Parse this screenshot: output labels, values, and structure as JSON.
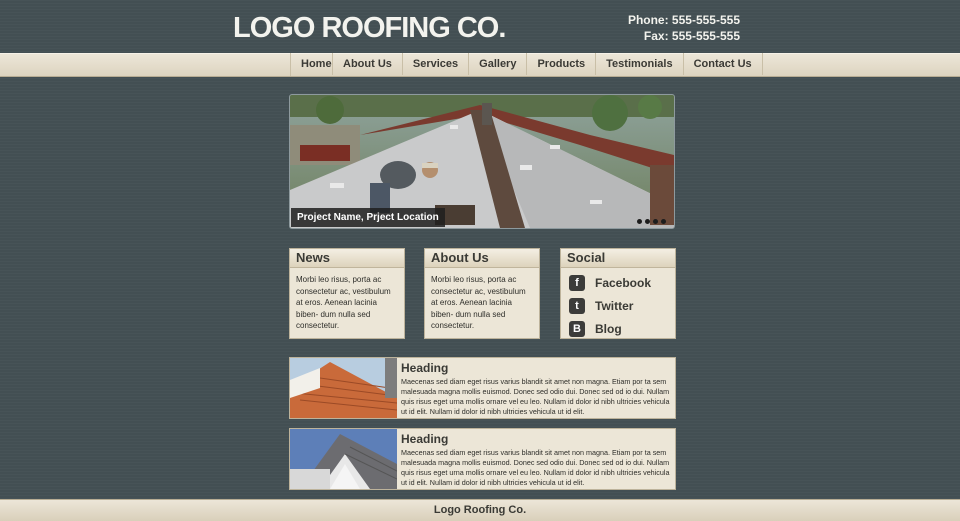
{
  "header": {
    "logo": "LOGO ROOFING CO.",
    "phone": "Phone: 555-555-555",
    "fax": "Fax: 555-555-555"
  },
  "nav": [
    "Home",
    "About Us",
    "Services",
    "Gallery",
    "Products",
    "Testimonials",
    "Contact Us"
  ],
  "slider": {
    "caption": "Project Name, Prject Location",
    "dots": 4
  },
  "news": {
    "title": "News",
    "body": "Morbi leo risus, porta ac consectetur ac, vestibulum at eros. Aenean lacinia biben- dum nulla sed consectetur."
  },
  "about": {
    "title": "About Us",
    "body": "Morbi leo risus, porta ac consectetur ac, vestibulum at eros. Aenean lacinia biben- dum nulla sed consectetur."
  },
  "social": {
    "title": "Social",
    "items": [
      {
        "label": "Facebook",
        "icon": "facebook-icon"
      },
      {
        "label": "Twitter",
        "icon": "twitter-icon"
      },
      {
        "label": "Blog",
        "icon": "blogger-icon"
      }
    ]
  },
  "articles": [
    {
      "heading": "Heading",
      "body": "Maecenas sed diam eget risus varius blandit sit amet non magna. Etiam por ta sem malesuada magna mollis euismod. Donec sed odio dui. Donec sed od io dui. Nullam quis risus eget urna mollis ornare vel eu leo. Nullam id dolor id nibh ultricies vehicula ut id elit. Nullam id dolor id nibh ultricies vehicula ut id elit."
    },
    {
      "heading": "Heading",
      "body": "Maecenas sed diam eget risus varius blandit sit amet non magna. Etiam por ta sem malesuada magna mollis euismod. Donec sed odio dui. Donec sed od io dui. Nullam quis risus eget urna mollis ornare vel eu leo. Nullam id dolor id nibh ultricies vehicula ut id elit. Nullam id dolor id nibh ultricies vehicula ut id elit."
    }
  ],
  "footer": "Logo Roofing Co.",
  "colors": {
    "background": "#434f53",
    "panel": "#ece6d7",
    "text": "#3a3a35"
  }
}
